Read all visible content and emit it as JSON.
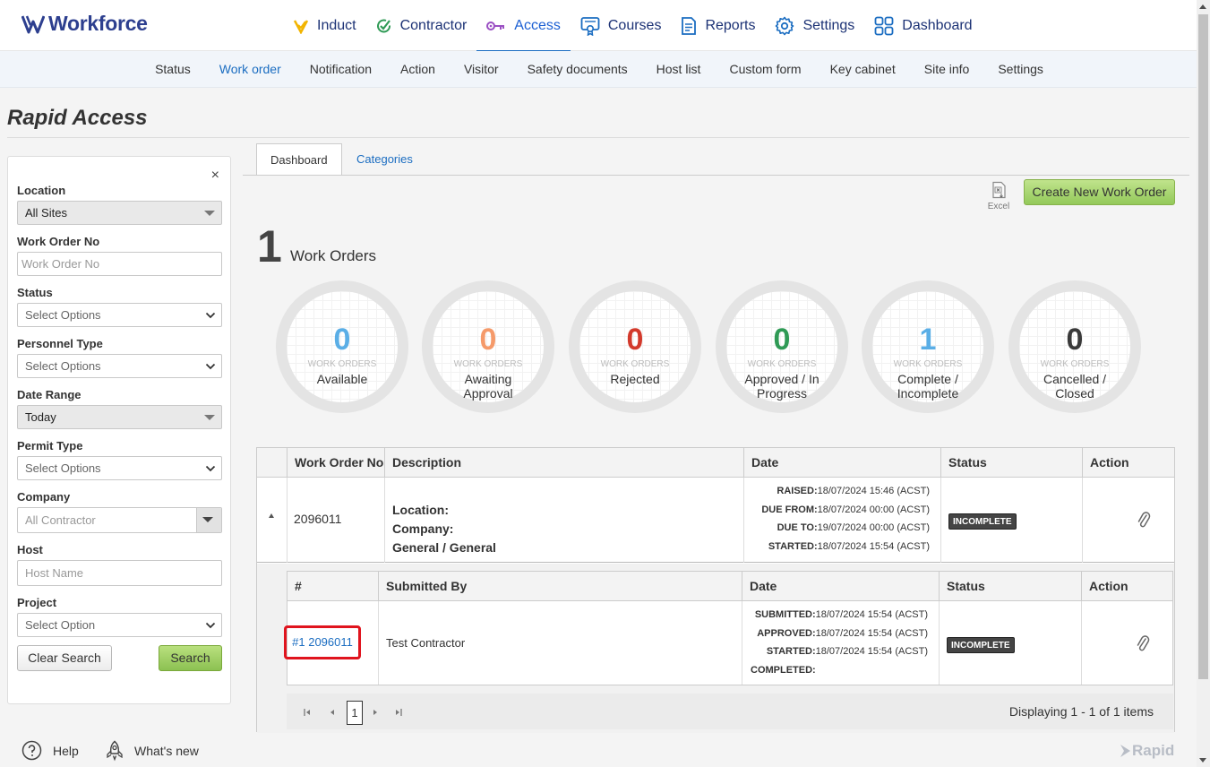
{
  "brand": {
    "name": "Workforce"
  },
  "main_menu": [
    {
      "label": "Induct",
      "icon": "induct-check-icon"
    },
    {
      "label": "Contractor",
      "icon": "contractor-check-icon"
    },
    {
      "label": "Access",
      "icon": "key-icon",
      "active": true
    },
    {
      "label": "Courses",
      "icon": "certificate-icon"
    },
    {
      "label": "Reports",
      "icon": "report-icon"
    },
    {
      "label": "Settings",
      "icon": "gear-icon"
    },
    {
      "label": "Dashboard",
      "icon": "grid-icon"
    }
  ],
  "sub_menu": [
    "Status",
    "Work order",
    "Notification",
    "Action",
    "Visitor",
    "Safety documents",
    "Host list",
    "Custom form",
    "Key cabinet",
    "Site info",
    "Settings"
  ],
  "page_title": "Rapid Access",
  "filters": {
    "close_label": "×",
    "location": {
      "label": "Location",
      "value": "All Sites"
    },
    "work_order_no": {
      "label": "Work Order No",
      "placeholder": "Work Order No"
    },
    "status": {
      "label": "Status",
      "value": "Select Options"
    },
    "personnel_type": {
      "label": "Personnel Type",
      "value": "Select Options"
    },
    "date_range": {
      "label": "Date Range",
      "value": "Today"
    },
    "permit_type": {
      "label": "Permit Type",
      "value": "Select Options"
    },
    "company": {
      "label": "Company",
      "value": "All Contractor"
    },
    "host": {
      "label": "Host",
      "placeholder": "Host Name"
    },
    "project": {
      "label": "Project",
      "value": "Select Option"
    },
    "clear_label": "Clear Search",
    "search_label": "Search"
  },
  "tabs": {
    "dashboard": "Dashboard",
    "categories": "Categories"
  },
  "toolbar": {
    "excel_label": "Excel",
    "create_label": "Create New Work Order"
  },
  "summary": {
    "count": "1",
    "label": "Work Orders"
  },
  "stats": [
    {
      "value": "0",
      "sub": "Work Orders",
      "label": "Available",
      "color": "#5aaee6"
    },
    {
      "value": "0",
      "sub": "Work Orders",
      "label": "Awaiting Approval",
      "color": "#f59a6a"
    },
    {
      "value": "0",
      "sub": "Work Orders",
      "label": "Rejected",
      "color": "#d33a2c"
    },
    {
      "value": "0",
      "sub": "Work Orders",
      "label": "Approved / In Progress",
      "color": "#2f9a55"
    },
    {
      "value": "1",
      "sub": "Work Orders",
      "label": "Complete / Incomplete",
      "color": "#5aaee6"
    },
    {
      "value": "0",
      "sub": "Work Orders",
      "label": "Cancelled / Closed",
      "color": "#3a3a3a"
    }
  ],
  "table": {
    "headers": {
      "work_order_no": "Work Order No",
      "description": "Description",
      "date": "Date",
      "status": "Status",
      "action": "Action"
    },
    "row": {
      "work_order_no": "2096011",
      "location_label": "Location:",
      "company_label": "Company:",
      "category": "General / General",
      "dates": [
        {
          "label": "RAISED:",
          "value": "18/07/2024 15:46 (ACST)"
        },
        {
          "label": "DUE FROM:",
          "value": "18/07/2024 00:00 (ACST)"
        },
        {
          "label": "DUE TO:",
          "value": "19/07/2024 00:00 (ACST)"
        },
        {
          "label": "STARTED:",
          "value": "18/07/2024 15:54 (ACST)"
        }
      ],
      "status": "INCOMPLETE"
    }
  },
  "sub_table": {
    "headers": {
      "num": "#",
      "submitted_by": "Submitted By",
      "date": "Date",
      "status": "Status",
      "action": "Action"
    },
    "row": {
      "num": "#1 2096011",
      "submitted_by": "Test Contractor",
      "dates": [
        {
          "label": "SUBMITTED:",
          "value": "18/07/2024 15:54 (ACST)"
        },
        {
          "label": "APPROVED:",
          "value": "18/07/2024 15:54 (ACST)"
        },
        {
          "label": "STARTED:",
          "value": "18/07/2024 15:54 (ACST)"
        },
        {
          "label": "COMPLETED:",
          "value": ""
        }
      ],
      "status": "INCOMPLETE"
    },
    "pager": {
      "page": "1",
      "info": "Displaying 1 - 1 of 1 items"
    }
  },
  "footer": {
    "help": "Help",
    "whats_new": "What's new",
    "rapid": "Rapid"
  }
}
